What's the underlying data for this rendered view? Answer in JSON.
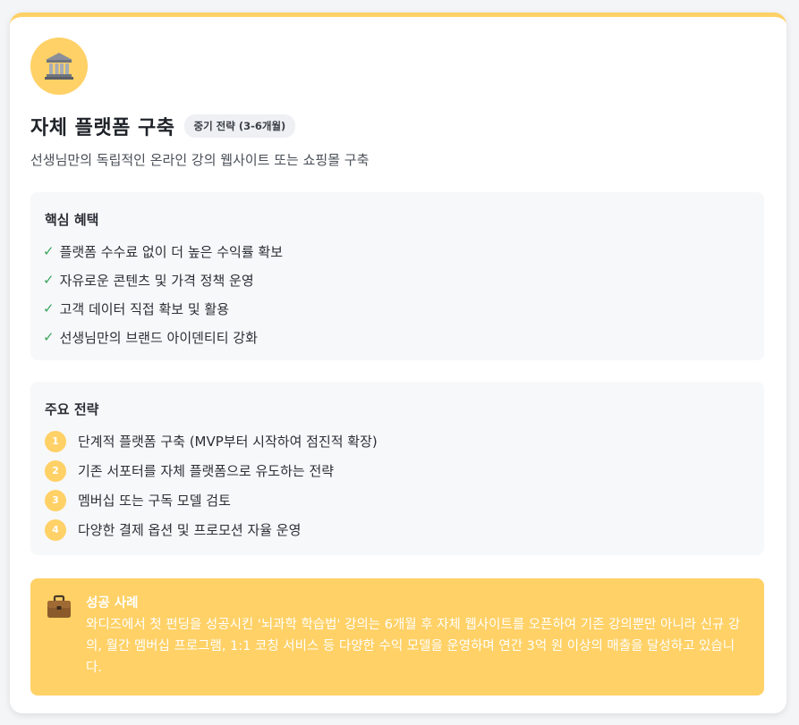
{
  "card": {
    "icon": "bank-building-icon",
    "title": "자체 플랫폼 구축",
    "badge": "중기 전략 (3-6개월)",
    "subtitle": "선생님만의 독립적인 온라인 강의 웹사이트 또는 쇼핑몰 구축"
  },
  "benefits": {
    "title": "핵심 혜택",
    "check_mark": "✓",
    "items": [
      "플랫폼 수수료 없이 더 높은 수익률 확보",
      "자유로운 콘텐츠 및 가격 정책 운영",
      "고객 데이터 직접 확보 및 활용",
      "선생님만의 브랜드 아이덴티티 강화"
    ]
  },
  "strategy": {
    "title": "주요 전략",
    "items": [
      {
        "num": "1",
        "text": "단계적 플랫폼 구축 (MVP부터 시작하여 점진적 확장)"
      },
      {
        "num": "2",
        "text": "기존 서포터를 자체 플랫폼으로 유도하는 전략"
      },
      {
        "num": "3",
        "text": "멤버십 또는 구독 모델 검토"
      },
      {
        "num": "4",
        "text": "다양한 결제 옵션 및 프로모션 자율 운영"
      }
    ]
  },
  "success": {
    "icon": "briefcase-icon",
    "title": "성공 사례",
    "body": "와디즈에서 첫 펀딩을 성공시킨 '뇌과학 학습법' 강의는 6개월 후 자체 웹사이트를 오픈하여 기존 강의뿐만 아니라 신규 강의, 월간 멤버십 프로그램, 1:1 코칭 서비스 등 다양한 수익 모델을 운영하며 연간 3억 원 이상의 매출을 달성하고 있습니다."
  },
  "colors": {
    "accent": "#ffd166",
    "check": "#3aa55d",
    "panel": "#f7f8fa"
  }
}
